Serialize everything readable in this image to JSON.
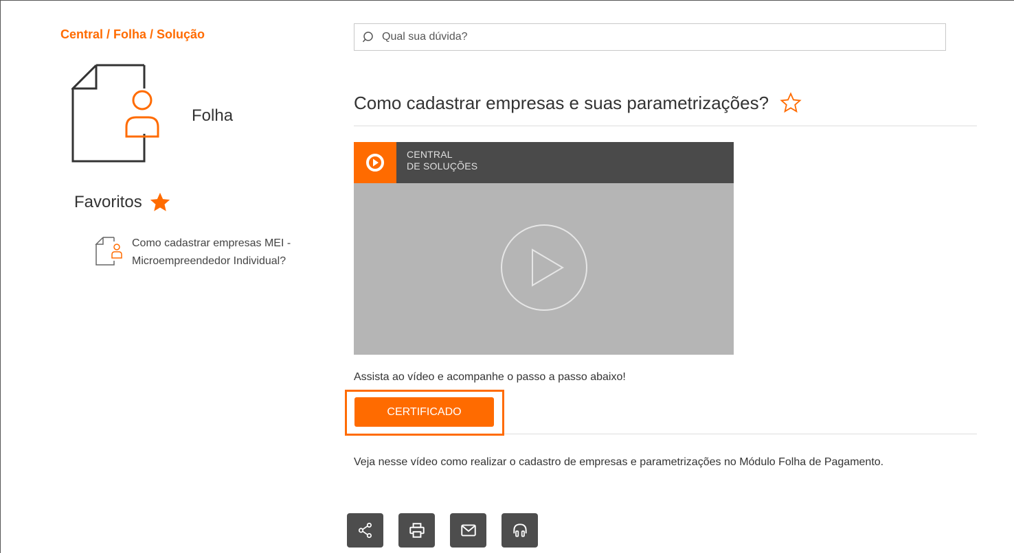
{
  "breadcrumb": "Central / Folha / Solução",
  "module": {
    "name": "Folha",
    "icon": "document-person-icon"
  },
  "favorites": {
    "label": "Favoritos",
    "items": [
      {
        "text": "Como cadastrar empresas MEI - Microempreendedor Individual?"
      }
    ]
  },
  "search": {
    "placeholder": "Qual sua dúvida?"
  },
  "article": {
    "title": "Como cadastrar empresas e suas parametrizações?",
    "video": {
      "channel": "CENTRAL\nDE SOLUÇÕES"
    },
    "instruction": "Assista ao vídeo e acompanhe o passo a passo abaixo!",
    "certificate_button": "CERTIFICADO",
    "description": "Veja nesse vídeo como realizar o cadastro de empresas e parametrizações no Módulo Folha de Pagamento."
  },
  "actions": [
    {
      "icon": "share-icon"
    },
    {
      "icon": "print-icon"
    },
    {
      "icon": "mail-icon"
    },
    {
      "icon": "headset-icon"
    }
  ],
  "colors": {
    "accent": "#ff6b00",
    "dark_button": "#4d4d4d",
    "video_bg": "#b5b5b5"
  }
}
